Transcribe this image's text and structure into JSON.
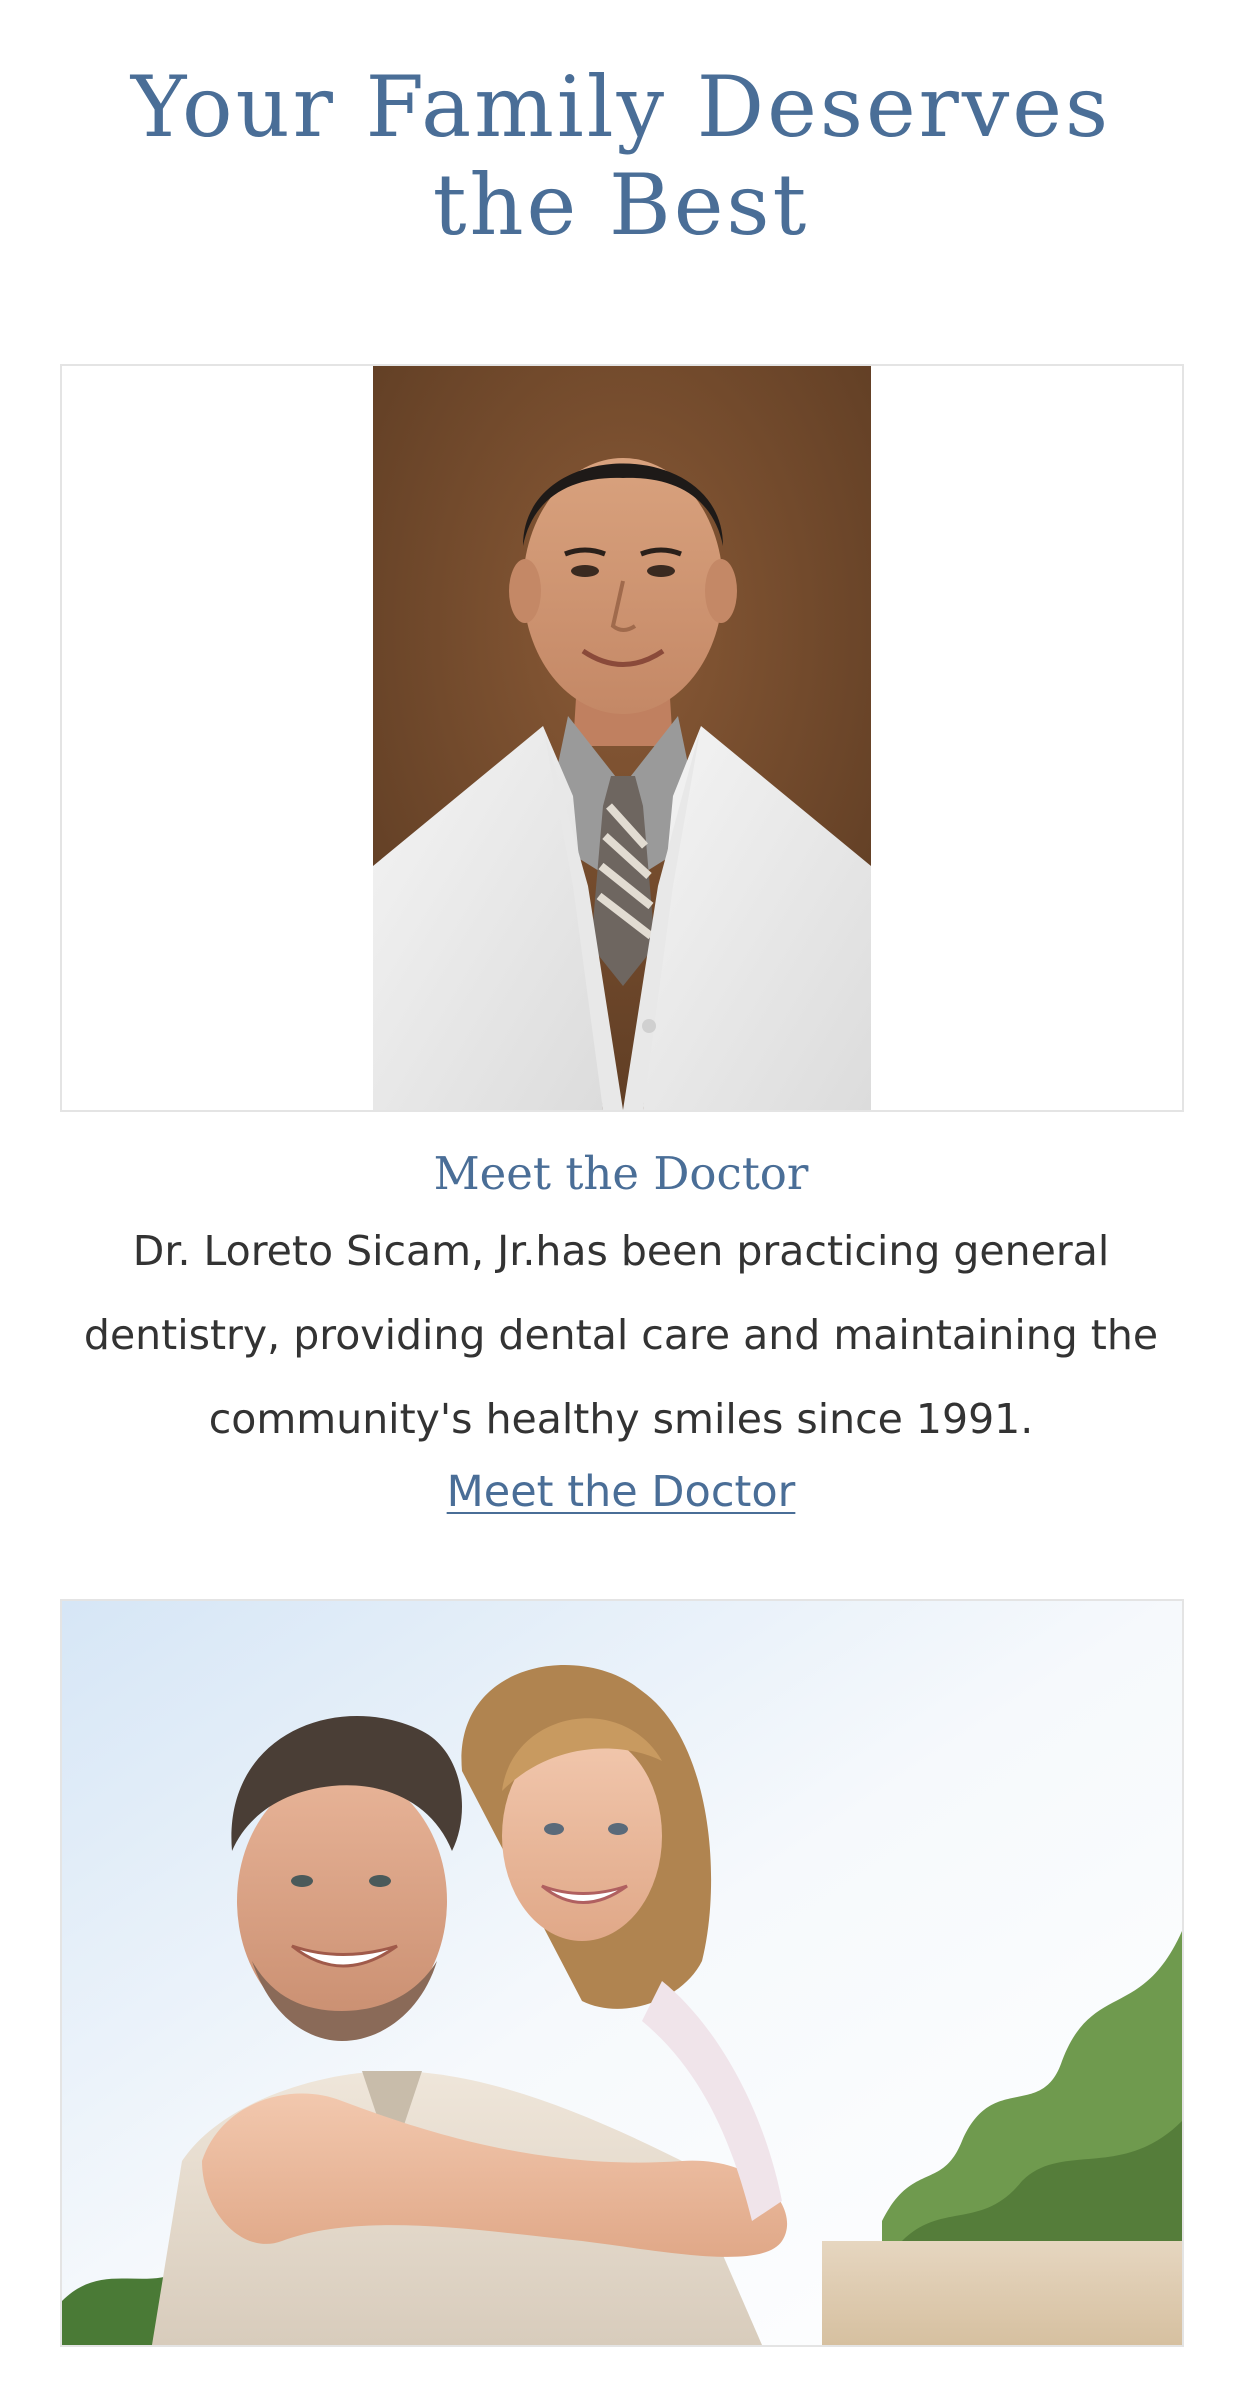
{
  "hero": {
    "title": "Your Family Deserves the Best"
  },
  "doctor_section": {
    "heading": "Meet the Doctor",
    "bio": "Dr. Loreto Sicam, Jr.has been practicing general dentistry, providing dental care and maintaining the community's healthy smiles since 1991.",
    "link_label": "Meet the Doctor"
  },
  "colors": {
    "accent": "#4a6e97",
    "body_text": "#333333",
    "frame_border": "#e4e4e4"
  }
}
